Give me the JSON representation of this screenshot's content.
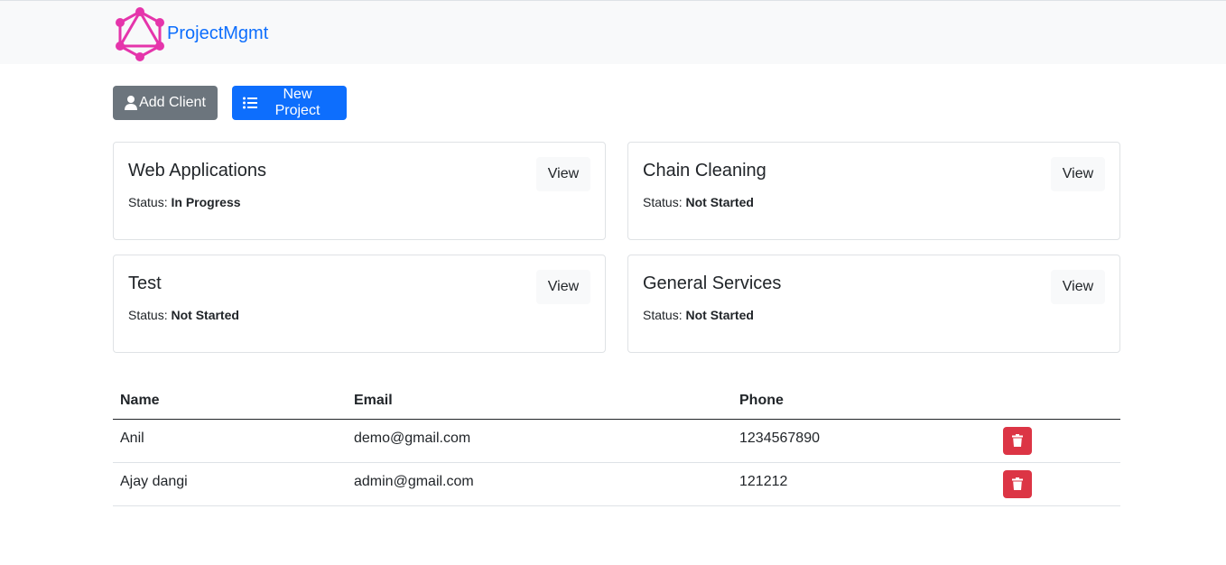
{
  "brand": {
    "name": "ProjectMgmt",
    "logo_icon": "graphql-logo-icon",
    "color": "#e535ab"
  },
  "toolbar": {
    "add_client_label": "Add Client",
    "add_client_icon": "user-icon",
    "new_project_label": "New Project",
    "new_project_icon": "list-icon"
  },
  "projects": [
    {
      "name": "Web Applications",
      "status_label": "Status:",
      "status": "In Progress",
      "view_label": "View"
    },
    {
      "name": "Chain Cleaning",
      "status_label": "Status:",
      "status": "Not Started",
      "view_label": "View"
    },
    {
      "name": "Test",
      "status_label": "Status:",
      "status": "Not Started",
      "view_label": "View"
    },
    {
      "name": "General Services",
      "status_label": "Status:",
      "status": "Not Started",
      "view_label": "View"
    }
  ],
  "clients": {
    "headers": {
      "name": "Name",
      "email": "Email",
      "phone": "Phone"
    },
    "rows": [
      {
        "name": "Anil",
        "email": "demo@gmail.com",
        "phone": "1234567890"
      },
      {
        "name": "Ajay dangi",
        "email": "admin@gmail.com",
        "phone": "121212"
      }
    ],
    "delete_icon": "trash-icon"
  },
  "colors": {
    "primary": "#0d6efd",
    "secondary": "#6c757d",
    "danger": "#dc3545",
    "navbar_bg": "#f8f9fa"
  }
}
